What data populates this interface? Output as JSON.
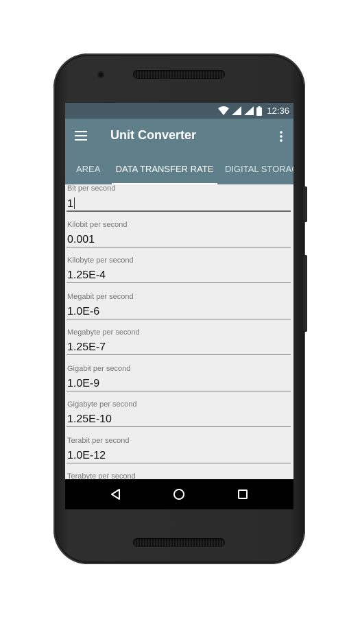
{
  "status_bar": {
    "time": "12:36",
    "icons": [
      "wifi-icon",
      "signal-icon",
      "signal-icon",
      "battery-icon"
    ]
  },
  "app_bar": {
    "title": "Unit Converter",
    "menu_icon": "hamburger-menu-icon",
    "overflow_icon": "more-vert-icon"
  },
  "tabs": [
    {
      "label": "AREA",
      "selected": false
    },
    {
      "label": "DATA TRANSFER RATE",
      "selected": true
    },
    {
      "label": "DIGITAL STORAG",
      "selected": false
    }
  ],
  "fields": [
    {
      "label": "Bit per second",
      "value": "1"
    },
    {
      "label": "Kilobit per second",
      "value": "0.001"
    },
    {
      "label": "Kilobyte per second",
      "value": "1.25E-4"
    },
    {
      "label": "Megabit per second",
      "value": "1.0E-6"
    },
    {
      "label": "Megabyte per second",
      "value": "1.25E-7"
    },
    {
      "label": "Gigabit per second",
      "value": "1.0E-9"
    },
    {
      "label": "Gigabyte per second",
      "value": "1.25E-10"
    },
    {
      "label": "Terabit per second",
      "value": "1.0E-12"
    },
    {
      "label": "Terabyte per second",
      "value": ""
    }
  ],
  "nav_bar": {
    "buttons": [
      "back-icon",
      "home-icon",
      "recents-icon"
    ]
  },
  "colors": {
    "status_bar": "#455a64",
    "app_bar": "#5f7f8a",
    "content_bg": "#eeeeee",
    "tab_indicator": "#ffffff"
  }
}
